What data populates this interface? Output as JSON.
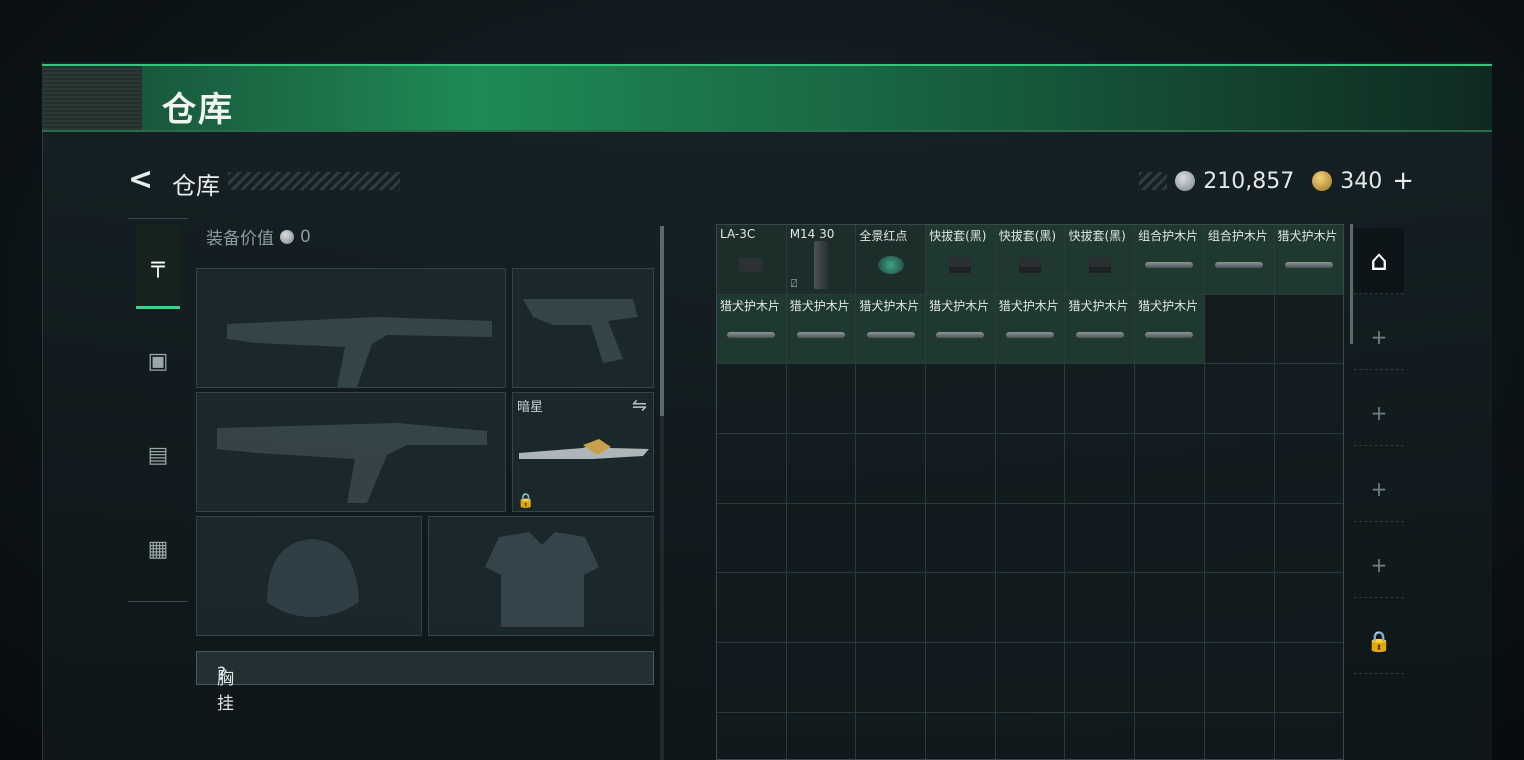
{
  "header": {
    "title": "仓库"
  },
  "subheader": {
    "title": "仓库",
    "back_icon": "chevron-left-icon"
  },
  "currency": {
    "silver": "210,857",
    "gold": "340",
    "add_label": "+"
  },
  "rail": [
    {
      "name": "weapon-icon",
      "glyph": "╤",
      "active": true
    },
    {
      "name": "armor-icon",
      "glyph": "▣",
      "active": false
    },
    {
      "name": "backpack-icon",
      "glyph": "▤",
      "active": false
    },
    {
      "name": "toolbox-icon",
      "glyph": "▦",
      "active": false
    }
  ],
  "equipment": {
    "value_label": "装备价值",
    "value": "0",
    "melee_name": "暗星",
    "swap_icon": "⇋",
    "lock_icon": "🔒",
    "section_label": "胸挂",
    "help_icon": "?"
  },
  "storage": {
    "items": [
      {
        "name": "LA-3C",
        "icon": "rail-mount"
      },
      {
        "name": "M14 30",
        "icon": "mag",
        "badge": "⍁"
      },
      {
        "name": "全景红点",
        "icon": "scope"
      },
      {
        "name": "快拔套(黑)",
        "icon": "pistol"
      },
      {
        "name": "快拔套(黑)",
        "icon": "pistol"
      },
      {
        "name": "快拔套(黑)",
        "icon": "pistol"
      },
      {
        "name": "组合护木片",
        "icon": "plank"
      },
      {
        "name": "组合护木片",
        "icon": "plank"
      },
      {
        "name": "猎犬护木片",
        "icon": "plank"
      },
      {
        "name": "猎犬护木片",
        "icon": "plank"
      },
      {
        "name": "猎犬护木片",
        "icon": "plank"
      },
      {
        "name": "猎犬护木片",
        "icon": "plank"
      },
      {
        "name": "猎犬护木片",
        "icon": "plank"
      },
      {
        "name": "猎犬护木片",
        "icon": "plank"
      },
      {
        "name": "猎犬护木片",
        "icon": "plank"
      },
      {
        "name": "猎犬护木片",
        "icon": "plank"
      }
    ],
    "total_cells": 72
  },
  "side_tabs": [
    {
      "name": "storage-tab-icon",
      "glyph": "⌂",
      "active": true
    },
    {
      "name": "add-tab-icon",
      "glyph": "+",
      "active": false
    },
    {
      "name": "add-tab-icon",
      "glyph": "+",
      "active": false
    },
    {
      "name": "add-tab-icon",
      "glyph": "+",
      "active": false
    },
    {
      "name": "add-tab-icon",
      "glyph": "+",
      "active": false
    },
    {
      "name": "lock-icon",
      "glyph": "🔒",
      "active": false
    }
  ]
}
